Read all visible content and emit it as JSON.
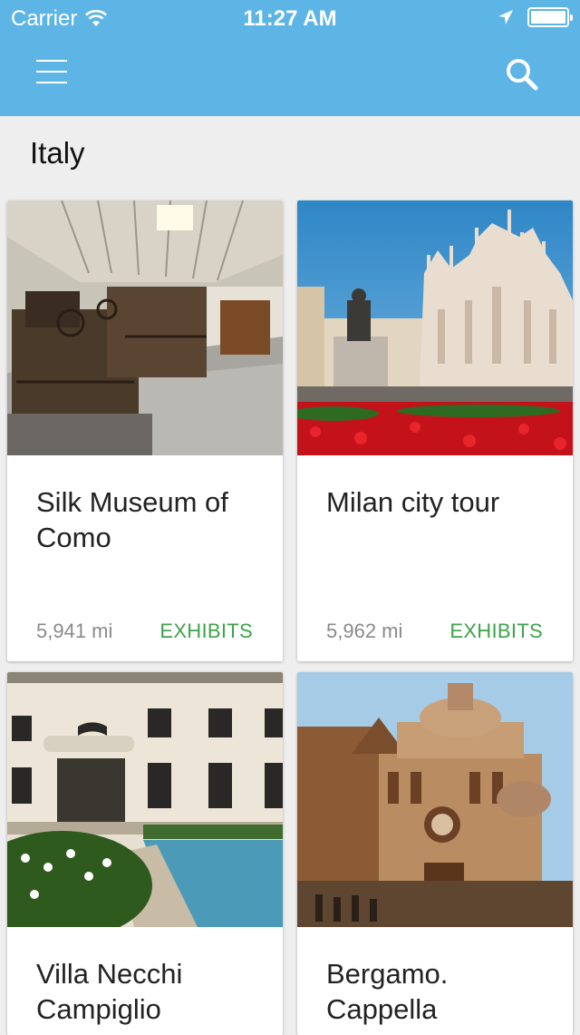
{
  "status_bar": {
    "carrier": "Carrier",
    "time": "11:27 AM"
  },
  "app_bar": {
    "background": "#5db5e6",
    "menu_icon": "hamburger-menu-icon",
    "search_icon": "search-icon"
  },
  "section": {
    "title": "Italy"
  },
  "cards": [
    {
      "title": "Silk Museum of Como",
      "distance": "5,941 mi",
      "action": "EXHIBITS",
      "image": "museum-interior-photo"
    },
    {
      "title": "Milan city tour",
      "distance": "5,962 mi",
      "action": "EXHIBITS",
      "image": "milan-cathedral-photo"
    },
    {
      "title": "Villa Necchi Campiglio",
      "image": "villa-pool-photo"
    },
    {
      "title": "Bergamo. Cappella",
      "image": "cappella-colleoni-photo"
    }
  ],
  "colors": {
    "accent_green": "#3ea34a",
    "background": "#eeeeee"
  }
}
